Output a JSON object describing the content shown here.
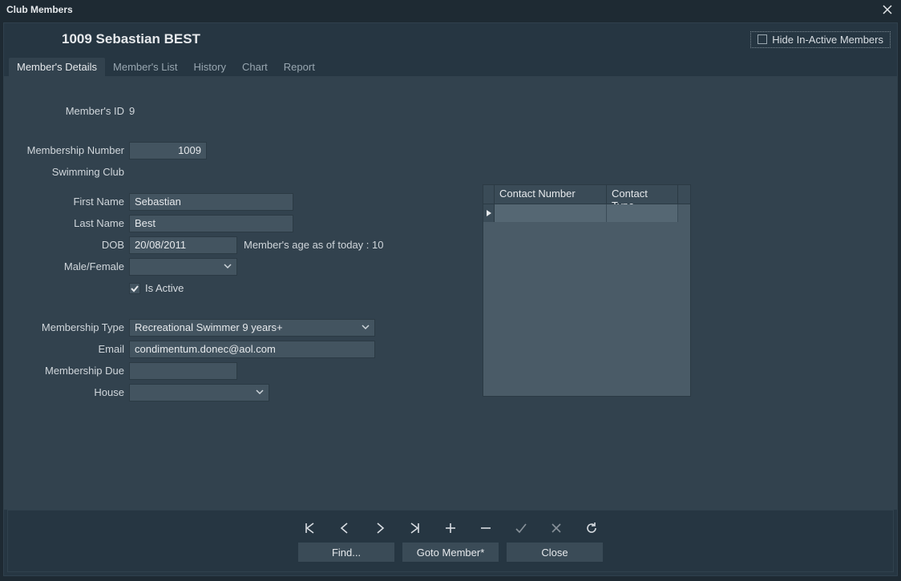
{
  "window": {
    "title": "Club Members"
  },
  "header": {
    "member_title": "1009 Sebastian BEST",
    "hide_inactive_label": "Hide In-Active Members",
    "hide_inactive_checked": false
  },
  "tabs": [
    {
      "label": "Member's Details",
      "active": true
    },
    {
      "label": "Member's List",
      "active": false
    },
    {
      "label": "History",
      "active": false
    },
    {
      "label": "Chart",
      "active": false
    },
    {
      "label": "Report",
      "active": false
    }
  ],
  "labels": {
    "member_id": "Member's ID",
    "membership_number": "Membership Number",
    "swimming_club": "Swimming Club",
    "first_name": "First Name",
    "last_name": "Last Name",
    "dob": "DOB",
    "age_note_prefix": "Member's age as of today :",
    "gender": "Male/Female",
    "is_active": "Is Active",
    "membership_type": "Membership Type",
    "email": "Email",
    "membership_due": "Membership Due",
    "house": "House"
  },
  "values": {
    "member_id": "9",
    "membership_number": "1009",
    "swimming_club": "",
    "first_name": "Sebastian",
    "last_name": "Best",
    "dob": "20/08/2011",
    "age": "10",
    "gender": "",
    "is_active_checked": true,
    "membership_type": "Recreational Swimmer 9 years+",
    "email": "condimentum.donec@aol.com",
    "membership_due": "",
    "house": ""
  },
  "contact_grid": {
    "columns": [
      "Contact Number",
      "Contact Type"
    ],
    "rows": [
      {
        "number": "",
        "type": ""
      }
    ]
  },
  "footer": {
    "buttons": {
      "find": "Find...",
      "goto": "Goto Member*",
      "close": "Close"
    }
  }
}
